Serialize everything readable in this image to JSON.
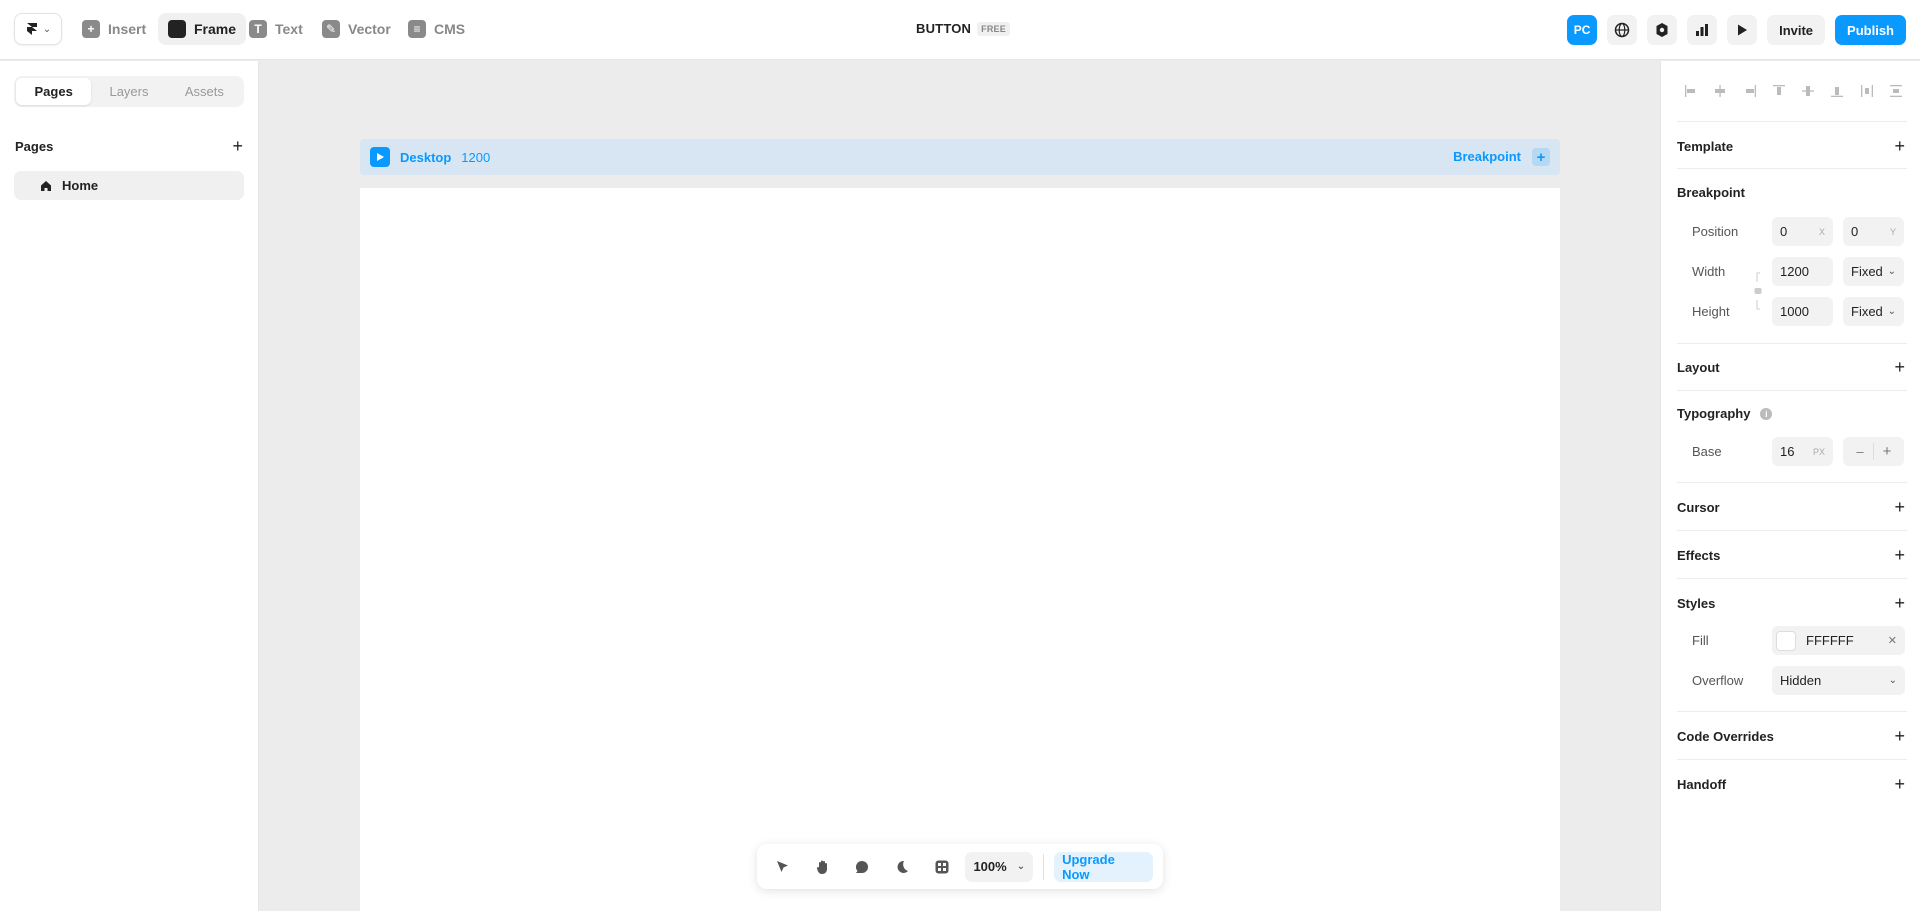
{
  "toolbar": {
    "tools": [
      {
        "label": "Insert",
        "icon": "plus-square-icon"
      },
      {
        "label": "Frame",
        "icon": "frame-icon"
      },
      {
        "label": "Text",
        "icon": "text-icon"
      },
      {
        "label": "Vector",
        "icon": "pen-icon"
      },
      {
        "label": "CMS",
        "icon": "database-icon"
      }
    ],
    "project_title": "BUTTON",
    "project_badge": "FREE",
    "avatar": "PC",
    "invite_label": "Invite",
    "publish_label": "Publish"
  },
  "left_panel": {
    "tabs": [
      "Pages",
      "Layers",
      "Assets"
    ],
    "active_tab": "Pages",
    "pages_header": "Pages",
    "pages": [
      "Home"
    ]
  },
  "canvas": {
    "frame_name": "Desktop",
    "frame_width": "1200",
    "breakpoint_label": "Breakpoint",
    "frame_color": "#FFFFFF"
  },
  "bottom_bar": {
    "zoom": "100%",
    "upgrade_label": "Upgrade Now"
  },
  "right_panel": {
    "template": "Template",
    "breakpoint": {
      "title": "Breakpoint",
      "position_label": "Position",
      "x": "0",
      "x_suffix": "X",
      "y": "0",
      "y_suffix": "Y",
      "width_label": "Width",
      "width": "1200",
      "width_mode": "Fixed",
      "height_label": "Height",
      "height": "1000",
      "height_mode": "Fixed"
    },
    "layout": "Layout",
    "typography": {
      "title": "Typography",
      "base_label": "Base",
      "base": "16",
      "base_unit": "PX"
    },
    "cursor": "Cursor",
    "effects": "Effects",
    "styles": {
      "title": "Styles",
      "fill_label": "Fill",
      "fill": "FFFFFF",
      "overflow_label": "Overflow",
      "overflow": "Hidden"
    },
    "code_overrides": "Code Overrides",
    "handoff": "Handoff"
  },
  "colors": {
    "accent": "#0A99FF",
    "canvas_bg": "#ECECEC",
    "frame_bar": "#D7E6F2"
  }
}
